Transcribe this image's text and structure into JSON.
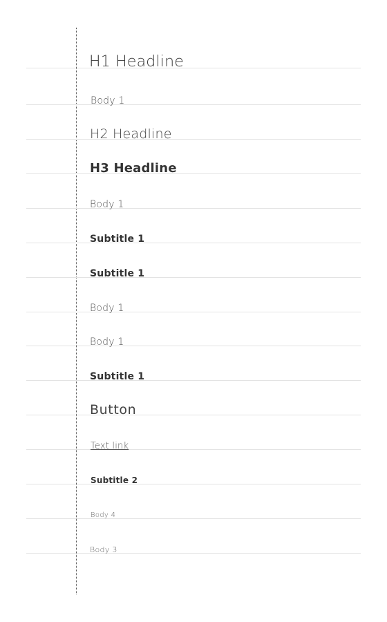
{
  "samples": [
    {
      "label": "H1 Headline",
      "style": "h1"
    },
    {
      "label": "Body 1",
      "style": "body1"
    },
    {
      "label": "H2 Headline",
      "style": "h2"
    },
    {
      "label": "H3 Headline",
      "style": "h3"
    },
    {
      "label": "Body 1",
      "style": "body1"
    },
    {
      "label": "Subtitle 1",
      "style": "subtitle1"
    },
    {
      "label": "Subtitle 1",
      "style": "subtitle1"
    },
    {
      "label": "Body 1",
      "style": "body1"
    },
    {
      "label": "Body 1",
      "style": "body1"
    },
    {
      "label": "Subtitle 1",
      "style": "subtitle1"
    },
    {
      "label": "Button",
      "style": "button-text"
    },
    {
      "label": "Text link",
      "style": "link-text"
    },
    {
      "label": "Subtitle 2",
      "style": "subtitle2"
    },
    {
      "label": "Body 4",
      "style": "body4"
    },
    {
      "label": "Body 3",
      "style": "body3"
    }
  ]
}
